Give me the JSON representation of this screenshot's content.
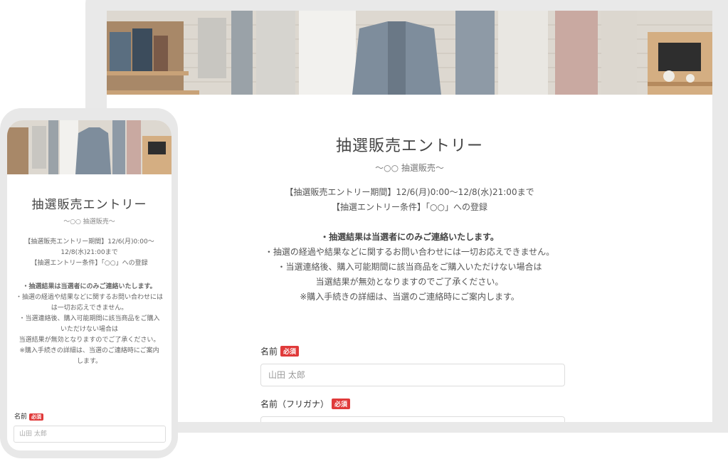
{
  "page": {
    "title": "抽選販売エントリー",
    "subtitle": "〜○○ 抽選販売〜",
    "period_line": "【抽選販売エントリー期間】12/6(月)0:00〜12/8(水)21:00まで",
    "period_line_mobile_1": "【抽選販売エントリー期間】12/6(月)0:00〜",
    "period_line_mobile_2": "12/8(水)21:00まで",
    "condition_line": "【抽選エントリー条件】「○○」への登録",
    "notice_bold": "・抽選結果は当選者にのみご連絡いたします。",
    "notice_lines": [
      "・抽選の経過や結果などに関するお問い合わせには一切お応えできません。",
      "・当選連絡後、購入可能期間に該当商品をご購入いただけない場合は",
      "当選結果が無効となりますのでご了承ください。",
      "※購入手続きの詳細は、当選のご連絡時にご案内します。"
    ],
    "notice_lines_mobile": [
      "・抽選の経過や結果などに関するお問い合わせには",
      "は一切お応えできません。",
      "・当選連絡後、購入可能期間に該当商品をご購入",
      "いただけない場合は",
      "当選結果が無効となりますのでご了承ください。",
      "※購入手続きの詳細は、当選のご連絡時にご案内",
      "します。"
    ]
  },
  "form": {
    "required_badge": "必須",
    "name_label": "名前",
    "name_placeholder": "山田 太郎",
    "kana_label": "名前（フリガナ）"
  },
  "colors": {
    "badge": "#e03a3a",
    "frame": "#e8e8e8"
  }
}
